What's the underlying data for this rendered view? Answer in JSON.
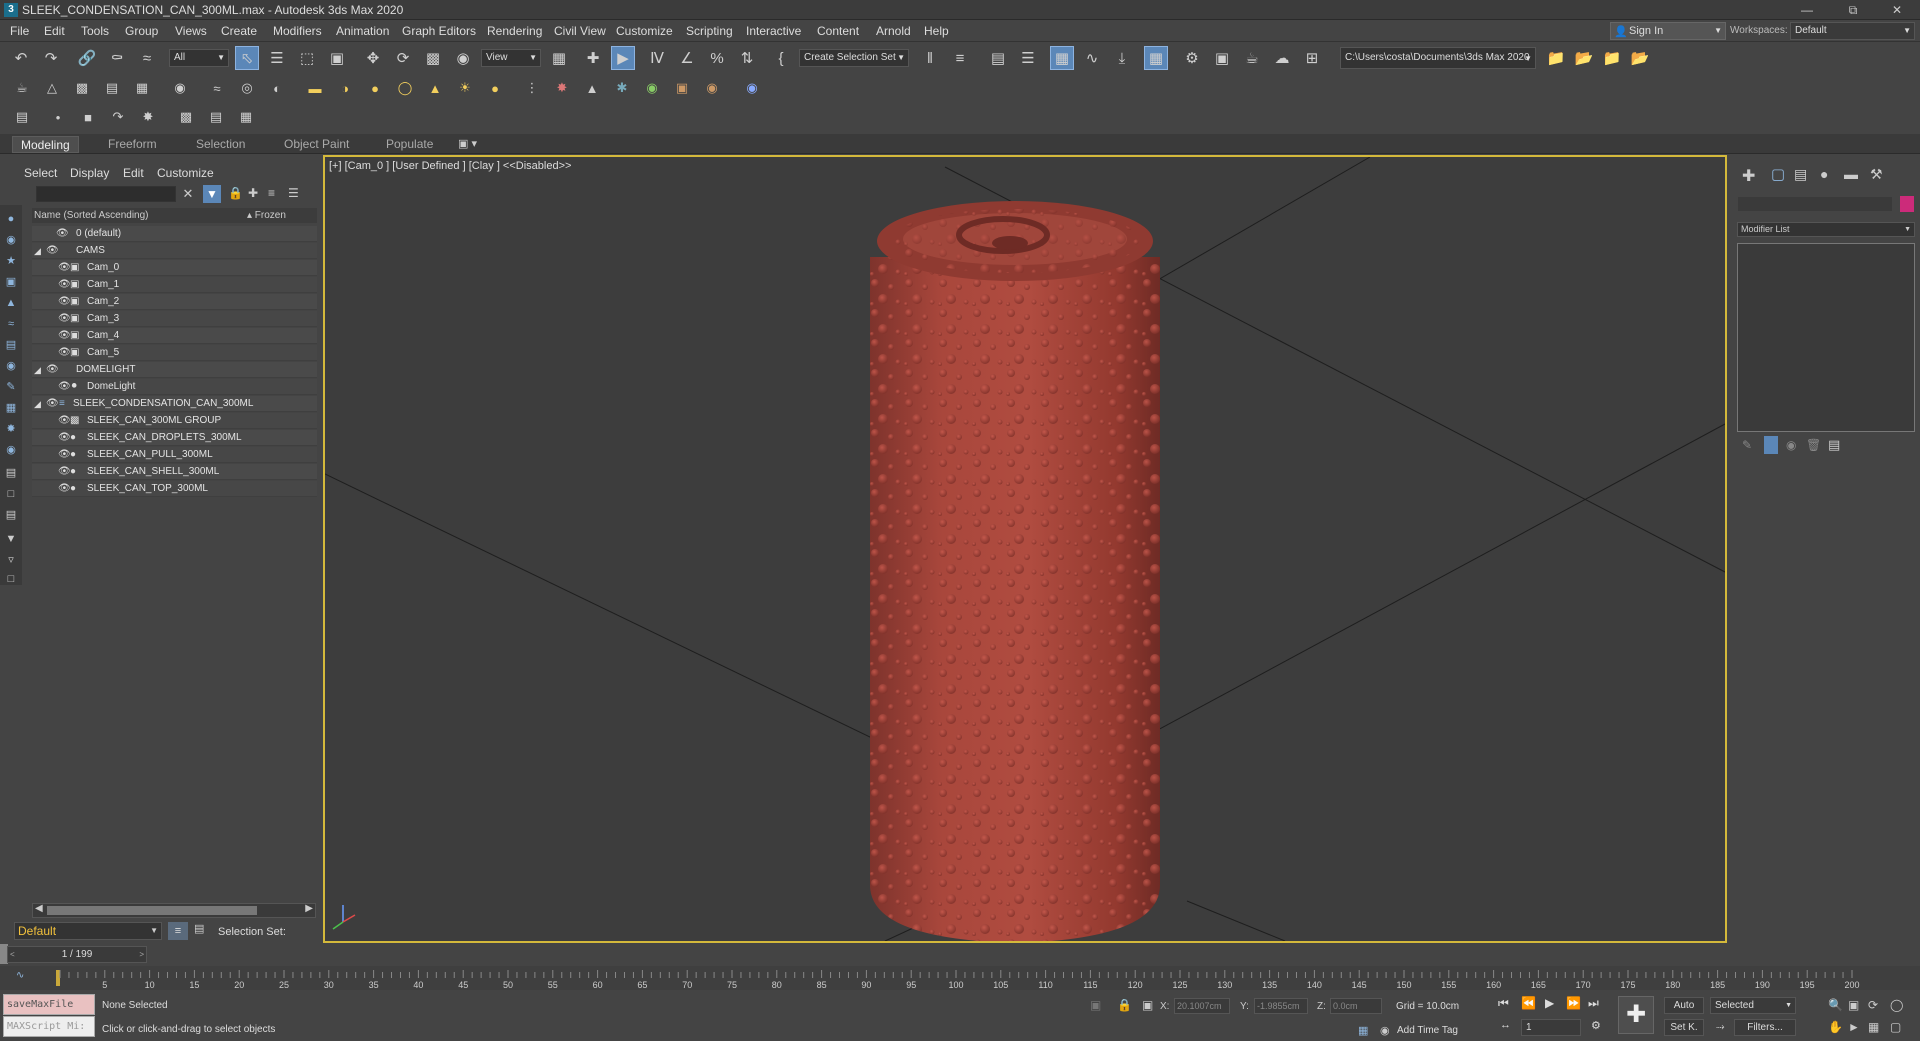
{
  "window": {
    "title": "SLEEK_CONDENSATION_CAN_300ML.max - Autodesk 3ds Max 2020",
    "app_icon": "3"
  },
  "menu": [
    "File",
    "Edit",
    "Tools",
    "Group",
    "Views",
    "Create",
    "Modifiers",
    "Animation",
    "Graph Editors",
    "Rendering",
    "Civil View",
    "Customize",
    "Scripting",
    "Interactive",
    "Content",
    "Arnold",
    "Help"
  ],
  "account": {
    "sign_in": "Sign In",
    "workspaces_label": "Workspaces:",
    "workspace": "Default"
  },
  "toolbar": {
    "selection_filter": "All",
    "ref_coord": "View",
    "named_selection": "Create Selection Set",
    "project_path": "C:\\Users\\costa\\Documents\\3ds Max 2020"
  },
  "ribbon_tabs": [
    "Modeling",
    "Freeform",
    "Selection",
    "Object Paint",
    "Populate"
  ],
  "scene_explorer": {
    "tabs": [
      "Select",
      "Display",
      "Edit",
      "Customize"
    ],
    "column_name": "Name (Sorted Ascending)",
    "column_frozen": "▴ Frozen",
    "rows": [
      {
        "label": "0 (default)",
        "level": 0
      },
      {
        "label": "CAMS",
        "level": 0
      },
      {
        "label": "Cam_0",
        "level": 1
      },
      {
        "label": "Cam_1",
        "level": 1
      },
      {
        "label": "Cam_2",
        "level": 1
      },
      {
        "label": "Cam_3",
        "level": 1
      },
      {
        "label": "Cam_4",
        "level": 1
      },
      {
        "label": "Cam_5",
        "level": 1
      },
      {
        "label": "DOMELIGHT",
        "level": 0
      },
      {
        "label": "DomeLight",
        "level": 1
      },
      {
        "label": "SLEEK_CONDENSATION_CAN_300ML",
        "level": 0
      },
      {
        "label": "SLEEK_CAN_300ML GROUP",
        "level": 1
      },
      {
        "label": "SLEEK_CAN_DROPLETS_300ML",
        "level": 1
      },
      {
        "label": "SLEEK_CAN_PULL_300ML",
        "level": 1
      },
      {
        "label": "SLEEK_CAN_SHELL_300ML",
        "level": 1
      },
      {
        "label": "SLEEK_CAN_TOP_300ML",
        "level": 1
      }
    ],
    "layer": "Default",
    "selection_set_label": "Selection Set:"
  },
  "viewport": {
    "label": "[+] [Cam_0 ] [User Defined ] [Clay ]  <<Disabled>>",
    "border_color": "#d4b93b",
    "can_color": "#a8453a"
  },
  "command_panel": {
    "modifier_list": "Modifier List",
    "color_swatch": "#cc2b7a"
  },
  "timeline": {
    "frame_display": "1 / 199",
    "ticks": [
      "5",
      "10",
      "15",
      "20",
      "25",
      "30",
      "35",
      "40",
      "45",
      "50",
      "55",
      "60",
      "65",
      "70",
      "75",
      "80",
      "85",
      "90",
      "95",
      "100",
      "105",
      "110",
      "115",
      "120",
      "125",
      "130",
      "135",
      "140",
      "145",
      "150",
      "155",
      "160",
      "165",
      "170",
      "175",
      "180",
      "185",
      "190",
      "195",
      "200"
    ]
  },
  "status": {
    "maxscript_line1": "saveMaxFile",
    "maxscript_line2": "MAXScript Mi:",
    "selection": "None Selected",
    "prompt": "Click or click-and-drag to select objects",
    "x_label": "X:",
    "x_value": "20.1007cm",
    "y_label": "Y:",
    "y_value": "-1.9855cm",
    "z_label": "Z:",
    "z_value": "0.0cm",
    "grid": "Grid = 10.0cm",
    "add_time_tag": "Add Time Tag",
    "auto_key": "Auto",
    "set_key": "Set K.",
    "key_mode": "Selected",
    "filters": "Filters...",
    "current_frame": "1"
  }
}
